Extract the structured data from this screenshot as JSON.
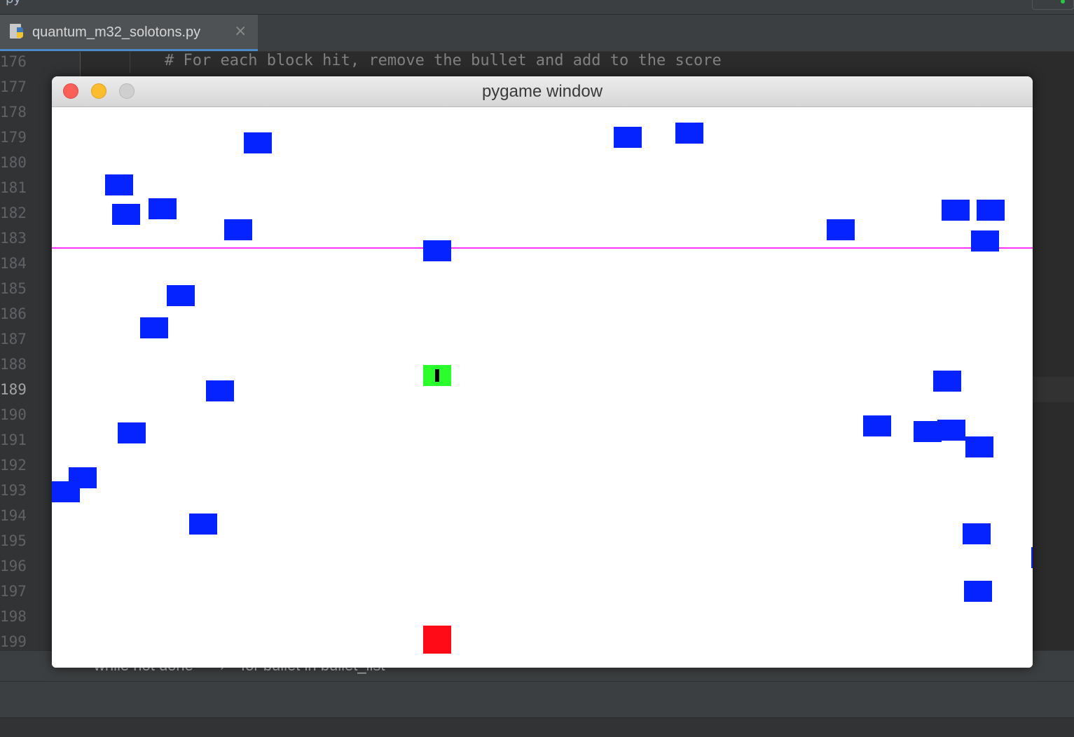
{
  "topbar": {
    "text": "py"
  },
  "tab": {
    "filename": "quantum_m32_solotons.py",
    "close_glyph": "×"
  },
  "editor": {
    "line_numbers": [
      "176",
      "177",
      "178",
      "179",
      "180",
      "181",
      "182",
      "183",
      "184",
      "185",
      "186",
      "187",
      "188",
      "189",
      "190",
      "191",
      "192",
      "193",
      "194",
      "195",
      "196",
      "197",
      "198",
      "199"
    ],
    "current_line": "189",
    "code_line_176": "# For each block hit, remove the bullet and add to the score"
  },
  "breadcrumb": {
    "first": "while not done",
    "separator": "›",
    "second": "for bullet in bullet_list"
  },
  "pygame": {
    "title": "pygame window",
    "colors": {
      "block": "#0523ff",
      "player": "#ff0a16",
      "hit_block": "#2bff2b",
      "bullet": "#000000",
      "target_line": "#ff33ff"
    },
    "block_count": 30
  }
}
